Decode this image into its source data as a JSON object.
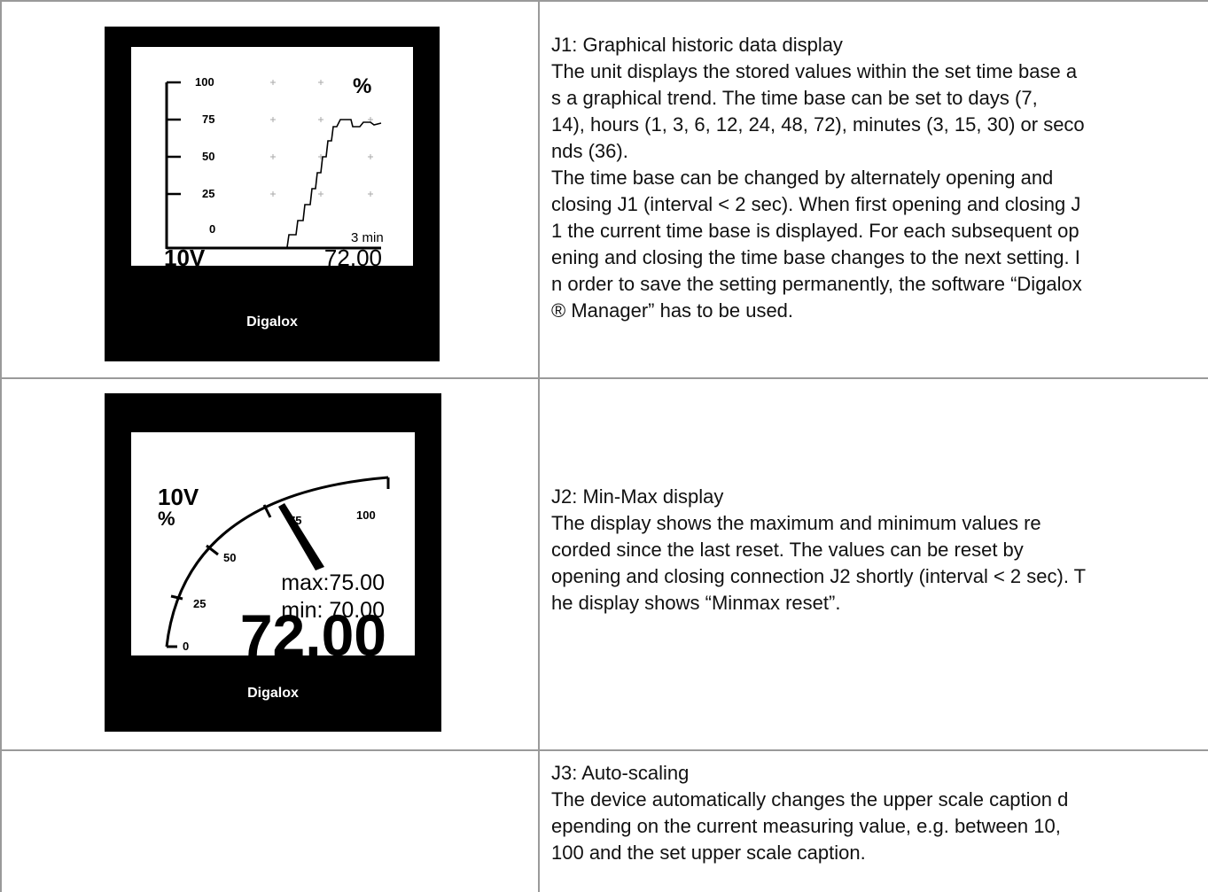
{
  "rows": [
    {
      "device": {
        "brand": "Digalox",
        "graph": {
          "y_ticks": [
            "100",
            "75",
            "50",
            "25",
            "0"
          ],
          "unit": "%",
          "time_base": "3 min",
          "channel": "10V",
          "value": "72.00"
        }
      },
      "title": "J1: Graphical historic data display",
      "body": "The unit  displays the stored values within the set time base a\ns a graphical trend. The time  base  can  be  set  to  days  (7,\n14), hours (1, 3, 6, 12, 24, 48, 72), minutes (3, 15, 30) or seco\nnds (36).\nThe  time  base  can  be  changed  by alternately opening and\nclosing J1 (interval < 2 sec). When first opening and closing J\n1 the current time base is displayed. For each subsequent op\nening and closing the time base changes to the next setting. I\nn order to save the setting permanently, the software “Digalox\n®  Manager” has to be used."
    },
    {
      "device": {
        "brand": "Digalox",
        "gauge": {
          "channel": "10V",
          "unit": "%",
          "ticks": [
            "0",
            "25",
            "50",
            "75",
            "100"
          ],
          "needle_value": 75,
          "max_label": "max:75.00",
          "min_label": "min: 70.00",
          "value": "72.00"
        }
      },
      "title": "J2: Min-Max display",
      "body": "The  display  shows  the  maximum  and minimum  values  re\ncorded  since  the  last reset. The values can be reset by\nopening and closing connection J2 shortly (interval < 2 sec). T\nhe display shows “Minmax reset”."
    },
    {
      "title": "J3: Auto-scaling",
      "body": "The device automatically changes the upper scale  caption  d\nepending  on  the  current measuring value, e.g. between 10,\n100 and the set upper scale caption."
    }
  ]
}
